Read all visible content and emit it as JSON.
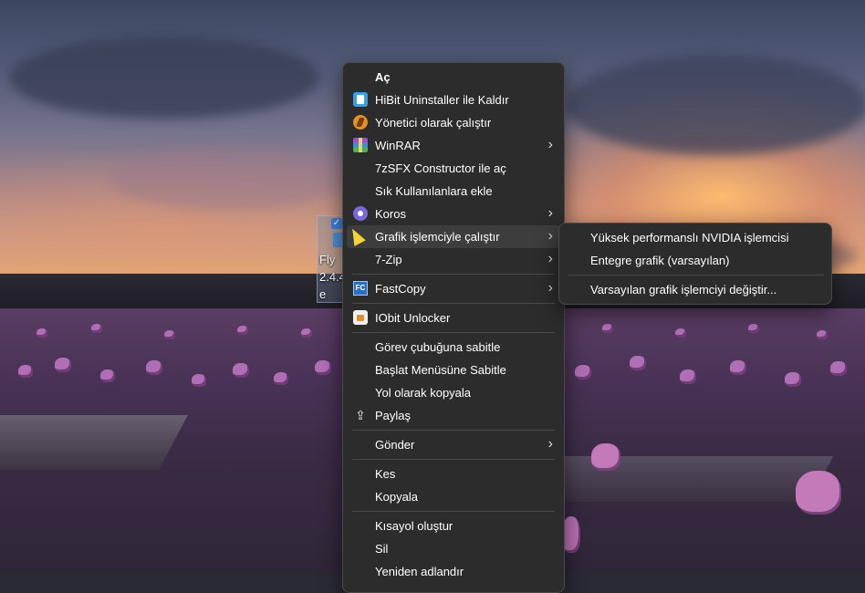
{
  "desktop": {
    "icon_label_lines": [
      "Fly",
      "2.4.4",
      "e"
    ],
    "icon_checked": true
  },
  "context_menu": {
    "items": [
      {
        "label": "Aç",
        "icon": "none",
        "bold": true,
        "submenu": false
      },
      {
        "label": "HiBit Uninstaller ile Kaldır",
        "icon": "hibit-uninstaller-icon",
        "submenu": false
      },
      {
        "label": "Yönetici olarak çalıştır",
        "icon": "run-as-admin-icon",
        "submenu": false
      },
      {
        "label": "WinRAR",
        "icon": "winrar-icon",
        "submenu": true
      },
      {
        "label": "7zSFX Constructor ile aç",
        "icon": "none",
        "submenu": false
      },
      {
        "label": "Sık Kullanılanlara ekle",
        "icon": "none",
        "submenu": false
      },
      {
        "label": "Koros",
        "icon": "koros-icon",
        "submenu": true
      },
      {
        "label": "Grafik işlemciyle çalıştır",
        "icon": "none",
        "submenu": true,
        "highlighted": true
      },
      {
        "label": "7-Zip",
        "icon": "none",
        "submenu": true
      },
      {
        "label": "FastCopy",
        "icon": "fastcopy-icon",
        "submenu": true
      },
      {
        "label": "IObit Unlocker",
        "icon": "iobit-unlocker-icon",
        "submenu": false
      },
      {
        "label": "Görev çubuğuna sabitle",
        "icon": "none",
        "submenu": false
      },
      {
        "label": "Başlat Menüsüne Sabitle",
        "icon": "none",
        "submenu": false
      },
      {
        "label": "Yol olarak kopyala",
        "icon": "none",
        "submenu": false
      },
      {
        "label": "Paylaş",
        "icon": "share-icon",
        "submenu": false
      },
      {
        "label": "Gönder",
        "icon": "none",
        "submenu": true
      },
      {
        "label": "Kes",
        "icon": "none",
        "submenu": false
      },
      {
        "label": "Kopyala",
        "icon": "none",
        "submenu": false
      },
      {
        "label": "Kısayol oluştur",
        "icon": "none",
        "submenu": false
      },
      {
        "label": "Sil",
        "icon": "none",
        "submenu": false
      },
      {
        "label": "Yeniden adlandır",
        "icon": "none",
        "submenu": false
      }
    ],
    "fastcopy_icon_text": "FC",
    "chevron": "›"
  },
  "gpu_submenu": {
    "items": [
      {
        "label": "Yüksek performanslı NVIDIA işlemcisi"
      },
      {
        "label": "Entegre grafik (varsayılan)"
      },
      {
        "label": "Varsayılan grafik işlemciyi değiştir..."
      }
    ]
  },
  "colors": {
    "menu_bg": "#2c2c2c",
    "menu_border": "#4a4a4a",
    "hover_bg": "#3d3d3d",
    "text": "#ffffff",
    "cursor": "#f3d33a"
  }
}
